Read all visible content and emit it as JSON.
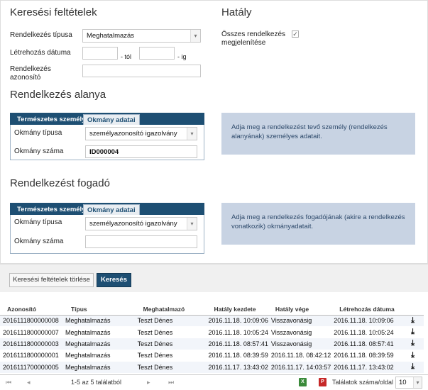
{
  "search": {
    "title": "Keresési feltételek",
    "type_label": "Rendelkezés típusa",
    "type_value": "Meghatalmazás",
    "created_label": "Létrehozás dátuma",
    "from_suffix": "- tól",
    "to_suffix": "- ig",
    "id_label_1": "Rendelkezés",
    "id_label_2": "azonosító"
  },
  "effect": {
    "title": "Hatály",
    "show_all_label_1": "Összes rendelkezés",
    "show_all_label_2": "megjelenítése",
    "show_all_checked": "✓"
  },
  "subject": {
    "title": "Rendelkezés alanya",
    "tab_person": "Természetes személy",
    "tab_document": "Okmány adatai",
    "doc_type_label": "Okmány típusa",
    "doc_type_value": "személyazonosító igazolvány",
    "doc_number_label": "Okmány száma",
    "doc_number_value": "ID000004",
    "info": "Adja meg a rendelkezést tevő személy (rendelkezés alanyának) személyes adatait."
  },
  "receiver": {
    "title": "Rendelkezést fogadó",
    "tab_person": "Természetes személy",
    "tab_document": "Okmány adatai",
    "doc_type_label": "Okmány típusa",
    "doc_type_value": "személyazonosító igazolvány",
    "doc_number_label": "Okmány száma",
    "doc_number_value": "",
    "info": "Adja meg a rendelkezés fogadójának (akire a rendelkezés vonatkozik) okmányadatait."
  },
  "actions": {
    "clear_label": "Keresési feltételek törlése",
    "search_label": "Keresés"
  },
  "table": {
    "columns": [
      "Azonosító",
      "Típus",
      "Meghatalmazó",
      "Hatály kezdete",
      "Hatály vége",
      "Létrehozás dátuma"
    ],
    "rows": [
      [
        "2016111800000008",
        "Meghatalmazás",
        "Teszt Dénes",
        "2016.11.18. 10:09:06",
        "Visszavonásig",
        "2016.11.18. 10:09:06"
      ],
      [
        "2016111800000007",
        "Meghatalmazás",
        "Teszt Dénes",
        "2016.11.18. 10:05:24",
        "Visszavonásig",
        "2016.11.18. 10:05:24"
      ],
      [
        "2016111800000003",
        "Meghatalmazás",
        "Teszt Dénes",
        "2016.11.18. 08:57:41",
        "Visszavonásig",
        "2016.11.18. 08:57:41"
      ],
      [
        "2016111800000001",
        "Meghatalmazás",
        "Teszt Dénes",
        "2016.11.18. 08:39:59",
        "2016.11.18. 08:42:12",
        "2016.11.18. 08:39:59"
      ],
      [
        "2016111700000005",
        "Meghatalmazás",
        "Teszt Dénes",
        "2016.11.17. 13:43:02",
        "2016.11.17. 14:03:57",
        "2016.11.17. 13:43:02"
      ]
    ]
  },
  "pager": {
    "summary": "1-5 az 5 találatból",
    "page_size_label": "Találatok száma/oldal",
    "page_size_value": "10",
    "excel_icon": "X",
    "pdf_icon": "P"
  }
}
